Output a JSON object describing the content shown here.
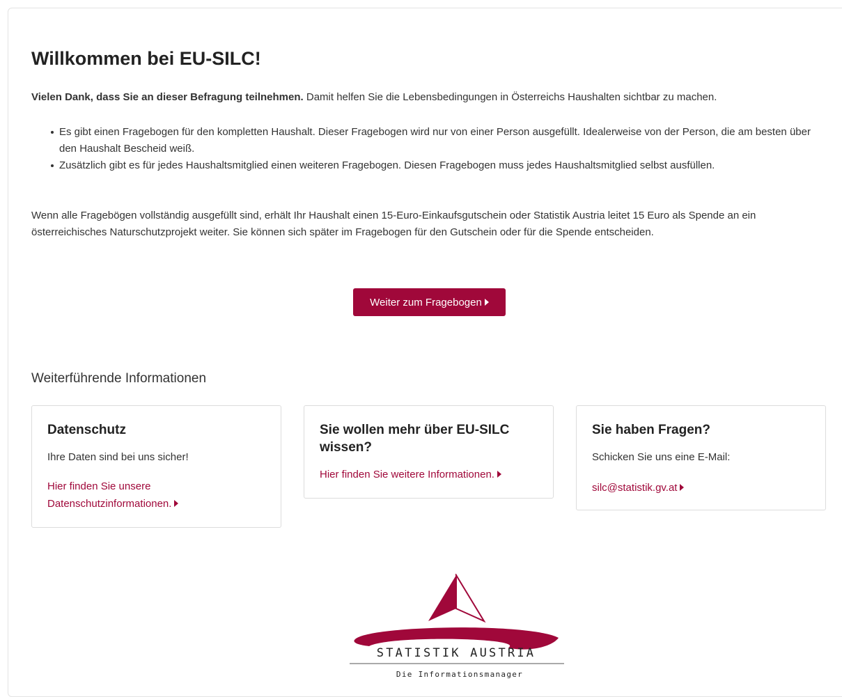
{
  "heading": "Willkommen bei EU-SILC!",
  "intro": {
    "bold": "Vielen Dank, dass Sie an dieser Befragung teilnehmen.",
    "rest": " Damit helfen Sie die Lebensbedingungen in Österreichs Haushalten sichtbar zu machen."
  },
  "bullets": [
    "Es gibt einen Fragebogen für den kompletten Haushalt. Dieser Fragebogen wird nur von einer Person ausgefüllt. Idealerweise von der Person, die am besten über den Haushalt Bescheid weiß.",
    "Zusätzlich gibt es für jedes Haushaltsmitglied einen weiteren Fragebogen. Diesen Fragebogen muss jedes Haushaltsmitglied selbst ausfüllen."
  ],
  "outro": "Wenn alle Fragebögen vollständig ausgefüllt sind, erhält Ihr Haushalt einen 15-Euro-Einkaufsgutschein oder Statistik Austria leitet 15 Euro als Spende an ein österreichisches Naturschutzprojekt weiter. Sie können sich später im Fragebogen für den Gutschein oder für die Spende entscheiden.",
  "cta_label": "Weiter zum Fragebogen",
  "section_title": "Weiterführende Informationen",
  "cards": [
    {
      "title": "Datenschutz",
      "text": "Ihre Daten sind bei uns sicher!",
      "link": "Hier finden Sie unsere Datenschutzinformationen."
    },
    {
      "title": "Sie wollen mehr über EU-SILC wissen?",
      "text": "",
      "link": "Hier finden Sie weitere Informationen."
    },
    {
      "title": "Sie haben Fragen?",
      "text": "Schicken Sie uns eine E-Mail:",
      "link": "silc@statistik.gv.at"
    }
  ],
  "logo": {
    "name": "STATISTIK AUSTRIA",
    "tagline": "Die Informationsmanager",
    "icon": "statistik-austria-logo"
  },
  "colors": {
    "accent": "#a0083a",
    "text": "#333333",
    "border": "#dcdcdc"
  }
}
